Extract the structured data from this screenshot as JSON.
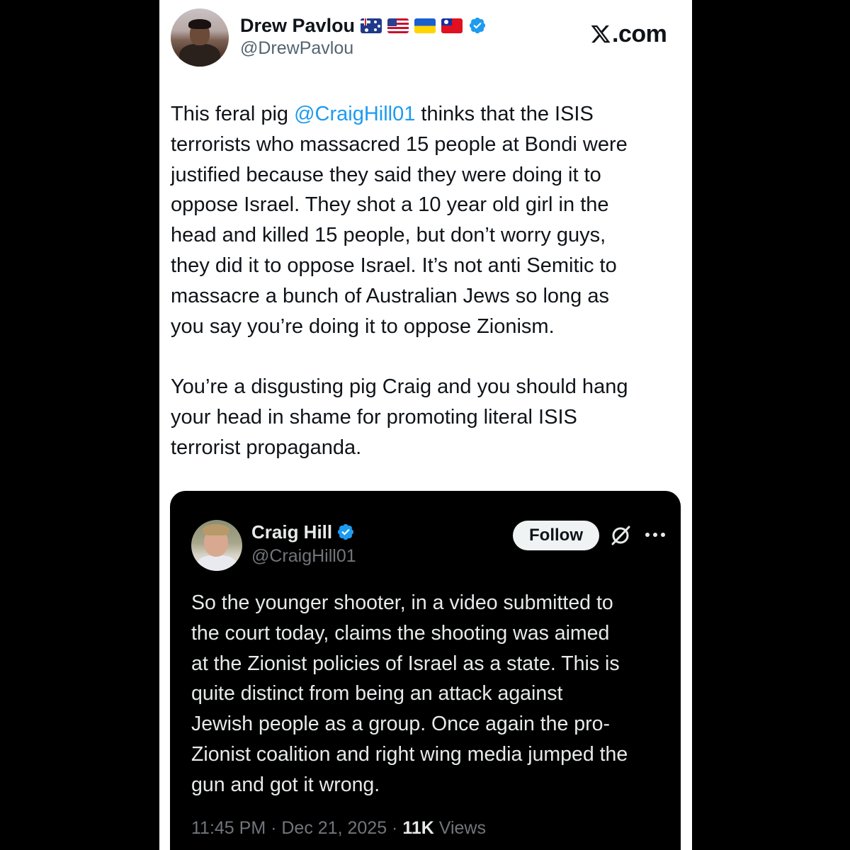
{
  "author": {
    "display_name": "Drew Pavlou",
    "handle": "@DrewPavlou",
    "flags": [
      "australia-flag",
      "usa-flag",
      "ukraine-flag",
      "taiwan-flag"
    ],
    "verified": true
  },
  "brand": {
    "x_glyph": "X",
    "domain": ".com"
  },
  "tweet": {
    "para1_before": "This feral pig ",
    "para1_mention": "@CraigHill01",
    "para1_after": " thinks that the ISIS\nterrorists who massacred 15 people at Bondi were\njustified because they said they were doing it to\noppose Israel. They shot a 10 year old girl in the\nhead and killed 15 people, but don’t worry guys,\nthey did it to oppose Israel. It’s not anti Semitic to\nmassacre a bunch of Australian Jews so long as\nyou say you’re doing it to oppose Zionism.\n\nYou’re a disgusting pig Craig and you should hang\nyour head in shame for promoting literal ISIS\nterrorist propaganda."
  },
  "quote": {
    "display_name": "Craig Hill",
    "handle": "@CraigHill01",
    "verified": true,
    "follow_label": "Follow",
    "text": "So the younger shooter, in a video submitted to\nthe court today, claims the shooting was aimed\nat the Zionist policies of Israel as a state. This is\nquite distinct from being an attack against\nJewish people as a group. Once again the pro-\nZionist coalition and right wing media jumped the\ngun and got it wrong.",
    "time": "11:45 PM",
    "separator": " · ",
    "date": "Dec 21, 2025",
    "views_count": "11K",
    "views_label": " Views"
  },
  "colors": {
    "mention": "#1d9bf0",
    "verified_badge": "#1d9bf0",
    "text_dark": "#0f1419",
    "text_muted_light": "#536471",
    "text_light": "#e7e9ea",
    "text_muted_dark": "#71767b",
    "quote_background": "#000000",
    "page_background": "#000000"
  }
}
